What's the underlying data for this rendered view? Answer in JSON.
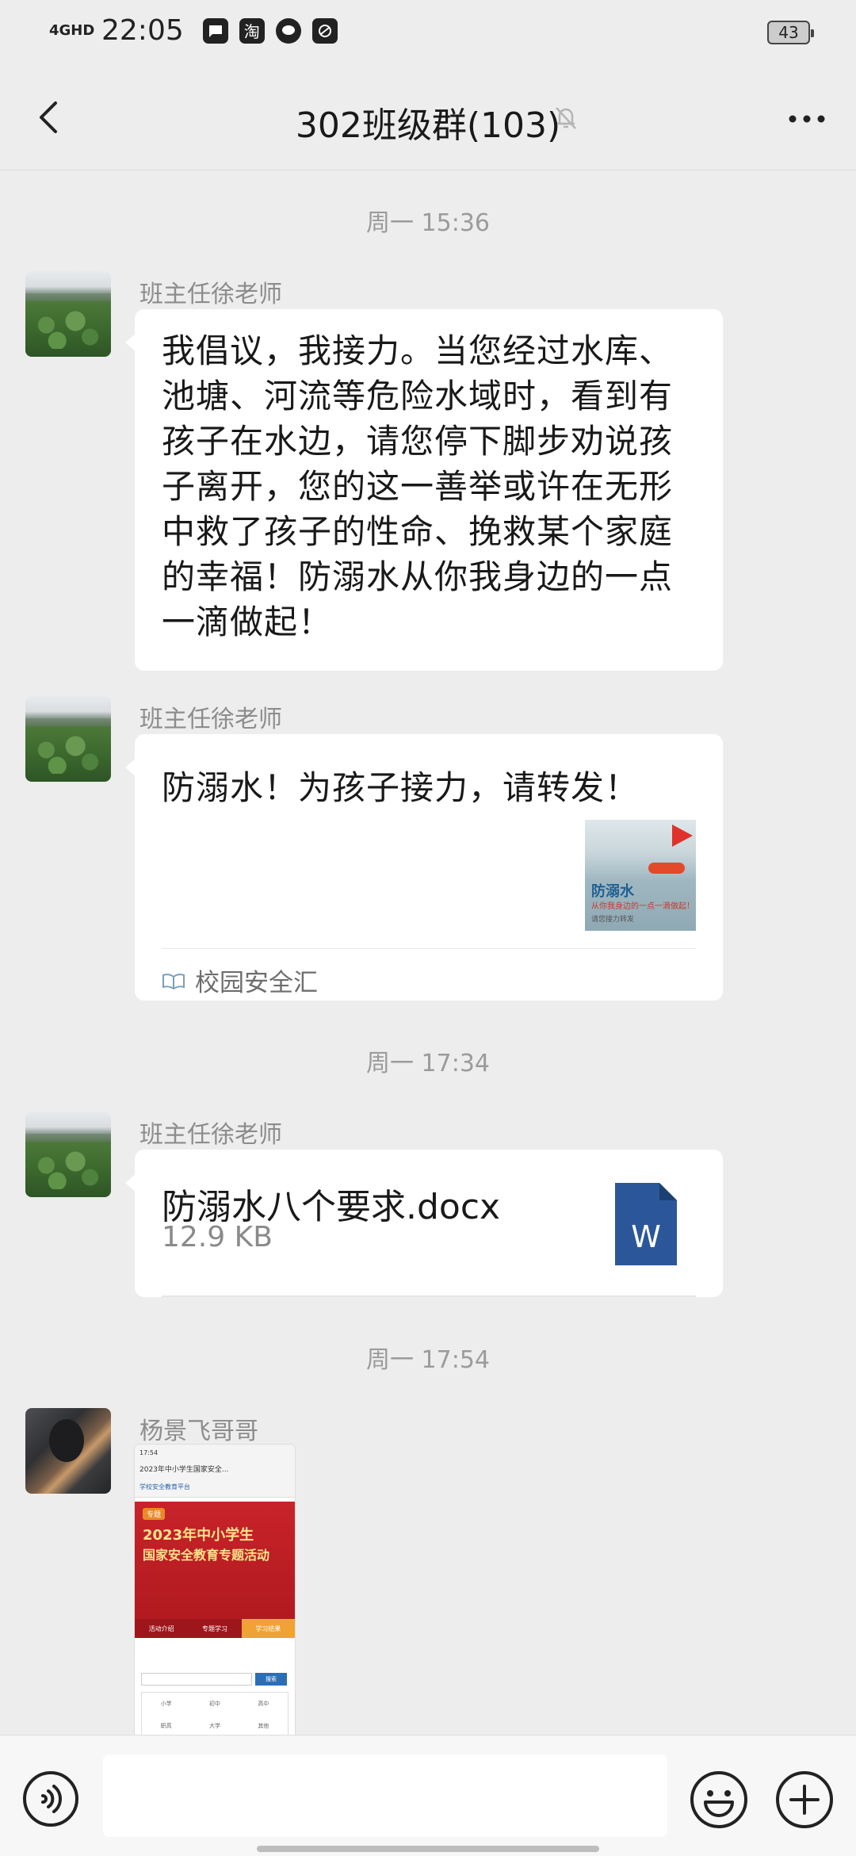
{
  "status_bar": {
    "network": "4GHD",
    "time": "22:05",
    "app_icons": [
      "message-icon",
      "taobao-icon",
      "chat-icon",
      "sync-icon"
    ],
    "taobao_glyph": "淘",
    "battery": "43"
  },
  "header": {
    "title": "302班级群(103)",
    "muted_icon": "mute-bell-icon",
    "back_icon": "back-chevron-icon",
    "more_icon": "more-dots-icon"
  },
  "messages": [
    {
      "type": "timestamp",
      "text": "周一 15:36"
    },
    {
      "type": "text",
      "sender": "班主任徐老师",
      "text_lines": [
        "我倡议，我接力。当您经过水库、",
        "池塘、河流等危险水域时，看到有",
        "孩子在水边，请您停下脚步劝说孩",
        "子离开，您的这一善举或许在无形",
        "中救了孩子的性命、挽救某个家庭",
        "的幸福！防溺水从你我身边的一点",
        "一滴做起！"
      ]
    },
    {
      "type": "link",
      "sender": "班主任徐老师",
      "title": "防溺水！为孩子接力，请转发！",
      "thumb_title": "防溺水",
      "thumb_subtitle": "从你我身边的一点一滴做起！",
      "thumb_footer": "请您接力转发",
      "source": "校园安全汇"
    },
    {
      "type": "timestamp",
      "text": "周一 17:34"
    },
    {
      "type": "file",
      "sender": "班主任徐老师",
      "file_name": "防溺水八个要求.docx",
      "file_size": "12.9 KB",
      "file_icon_letter": "W"
    },
    {
      "type": "timestamp",
      "text": "周一 17:54"
    },
    {
      "type": "image",
      "sender": "杨景飞哥哥",
      "image": {
        "status_line": "17:54",
        "page_title": "2023年中小学生国家安全...",
        "site_name": "学校安全教育平台",
        "tag": "专题",
        "headline_1": "2023年中小学生",
        "headline_2": "国家安全教育专题活动",
        "tabs": [
          "活动介绍",
          "专题学习",
          "学习结果"
        ],
        "search_button": "搜索",
        "grid": [
          "小学",
          "初中",
          "高中",
          "职高",
          "大学",
          "其他"
        ]
      }
    }
  ],
  "input_bar": {
    "voice_icon": "voice-icon",
    "emoji_icon": "emoji-icon",
    "plus_icon": "plus-icon",
    "placeholder": ""
  }
}
